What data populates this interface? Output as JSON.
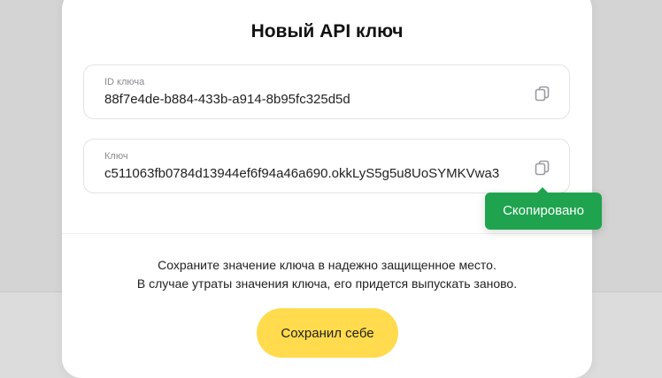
{
  "modal": {
    "title": "Новый API ключ",
    "id_field": {
      "label": "ID ключа",
      "value": "88f7e4de-b884-433b-a914-8b95fc325d5d",
      "copy_icon": "copy-icon"
    },
    "key_field": {
      "label": "Ключ",
      "value": "c511063fb0784d13944ef6f94a46a690.okkLyS5g5u8UoSYMKVwa3",
      "copy_icon": "copy-icon"
    },
    "note_line1": "Сохраните значение ключа в надежно защищенное место.",
    "note_line2": "В случае утраты значения ключа, его придется выпускать заново.",
    "save_label": "Сохранил себе"
  },
  "tooltip": {
    "text": "Скопировано",
    "color": "#1fa34f"
  },
  "colors": {
    "accent_button": "#ffdb4d"
  }
}
